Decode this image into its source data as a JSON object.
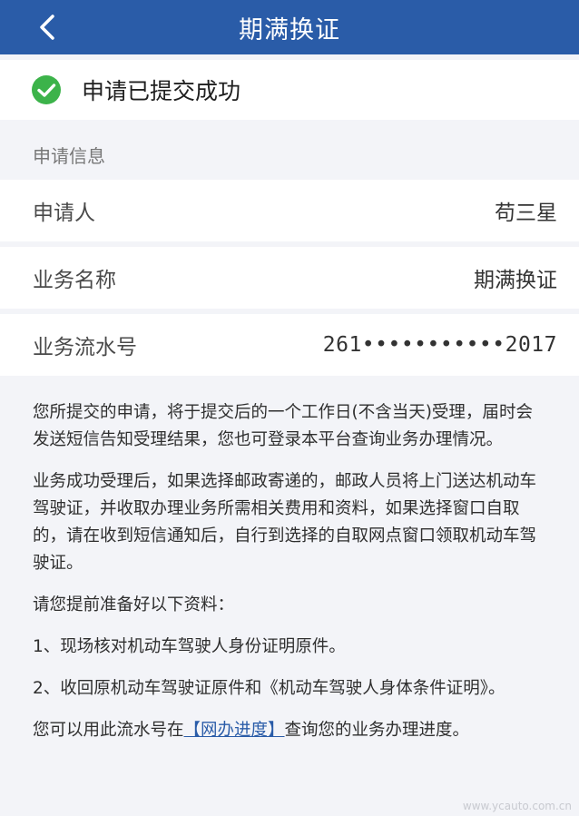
{
  "header": {
    "title": "期满换证",
    "back_icon": "chevron-left-icon"
  },
  "status": {
    "text": "申请已提交成功",
    "icon": "check-circle-icon",
    "color": "#3cb34a"
  },
  "section": {
    "title": "申请信息"
  },
  "rows": [
    {
      "label": "申请人",
      "value": "苟三星"
    },
    {
      "label": "业务名称",
      "value": "期满换证"
    },
    {
      "label": "业务流水号",
      "value": "261•••••••••••2017"
    }
  ],
  "notice": {
    "p1": "您所提交的申请，将于提交后的一个工作日(不含当天)受理，届时会发送短信告知受理结果，您也可登录本平台查询业务办理情况。",
    "p2": "业务成功受理后，如果选择邮政寄递的，邮政人员将上门送达机动车驾驶证，并收取办理业务所需相关费用和资料，如果选择窗口自取的，请在收到短信通知后，自行到选择的自取网点窗口领取机动车驾驶证。",
    "p3": "请您提前准备好以下资料：",
    "p4": "1、现场核对机动车驾驶人身份证明原件。",
    "p5": "2、收回原机动车驾驶证原件和《机动车驾驶人身体条件证明》。",
    "p6_prefix": "您可以用此流水号在",
    "p6_link": "【网办进度】",
    "p6_suffix": "查询您的业务办理进度。"
  },
  "watermark": "www.ycauto.com.cn",
  "colors": {
    "header_bg": "#2a5ca8",
    "link": "#2a5ca8",
    "page_bg": "#f3f4f8"
  }
}
